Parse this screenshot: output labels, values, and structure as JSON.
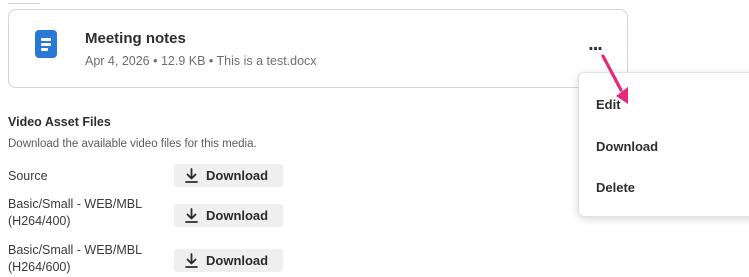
{
  "file_card": {
    "title": "Meeting notes",
    "meta": "Apr 4, 2026 • 12.9 KB • This is a test.docx",
    "more_label": "..."
  },
  "video_assets": {
    "title": "Video Asset Files",
    "description": "Download the available video files for this media.",
    "rows": [
      {
        "label": "Source",
        "button_label": "Download"
      },
      {
        "label": "Basic/Small - WEB/MBL (H264/400)",
        "button_label": "Download"
      },
      {
        "label": "Basic/Small - WEB/MBL (H264/600)",
        "button_label": "Download"
      }
    ]
  },
  "menu": {
    "items": [
      {
        "label": "Edit"
      },
      {
        "label": "Download"
      },
      {
        "label": "Delete"
      }
    ]
  },
  "colors": {
    "doc_icon": "#2a78d6",
    "annotation_arrow": "#e6287d",
    "button_bg": "#efefef"
  },
  "icons": [
    "document-icon",
    "more-icon",
    "download-icon",
    "annotation-arrow-icon"
  ]
}
